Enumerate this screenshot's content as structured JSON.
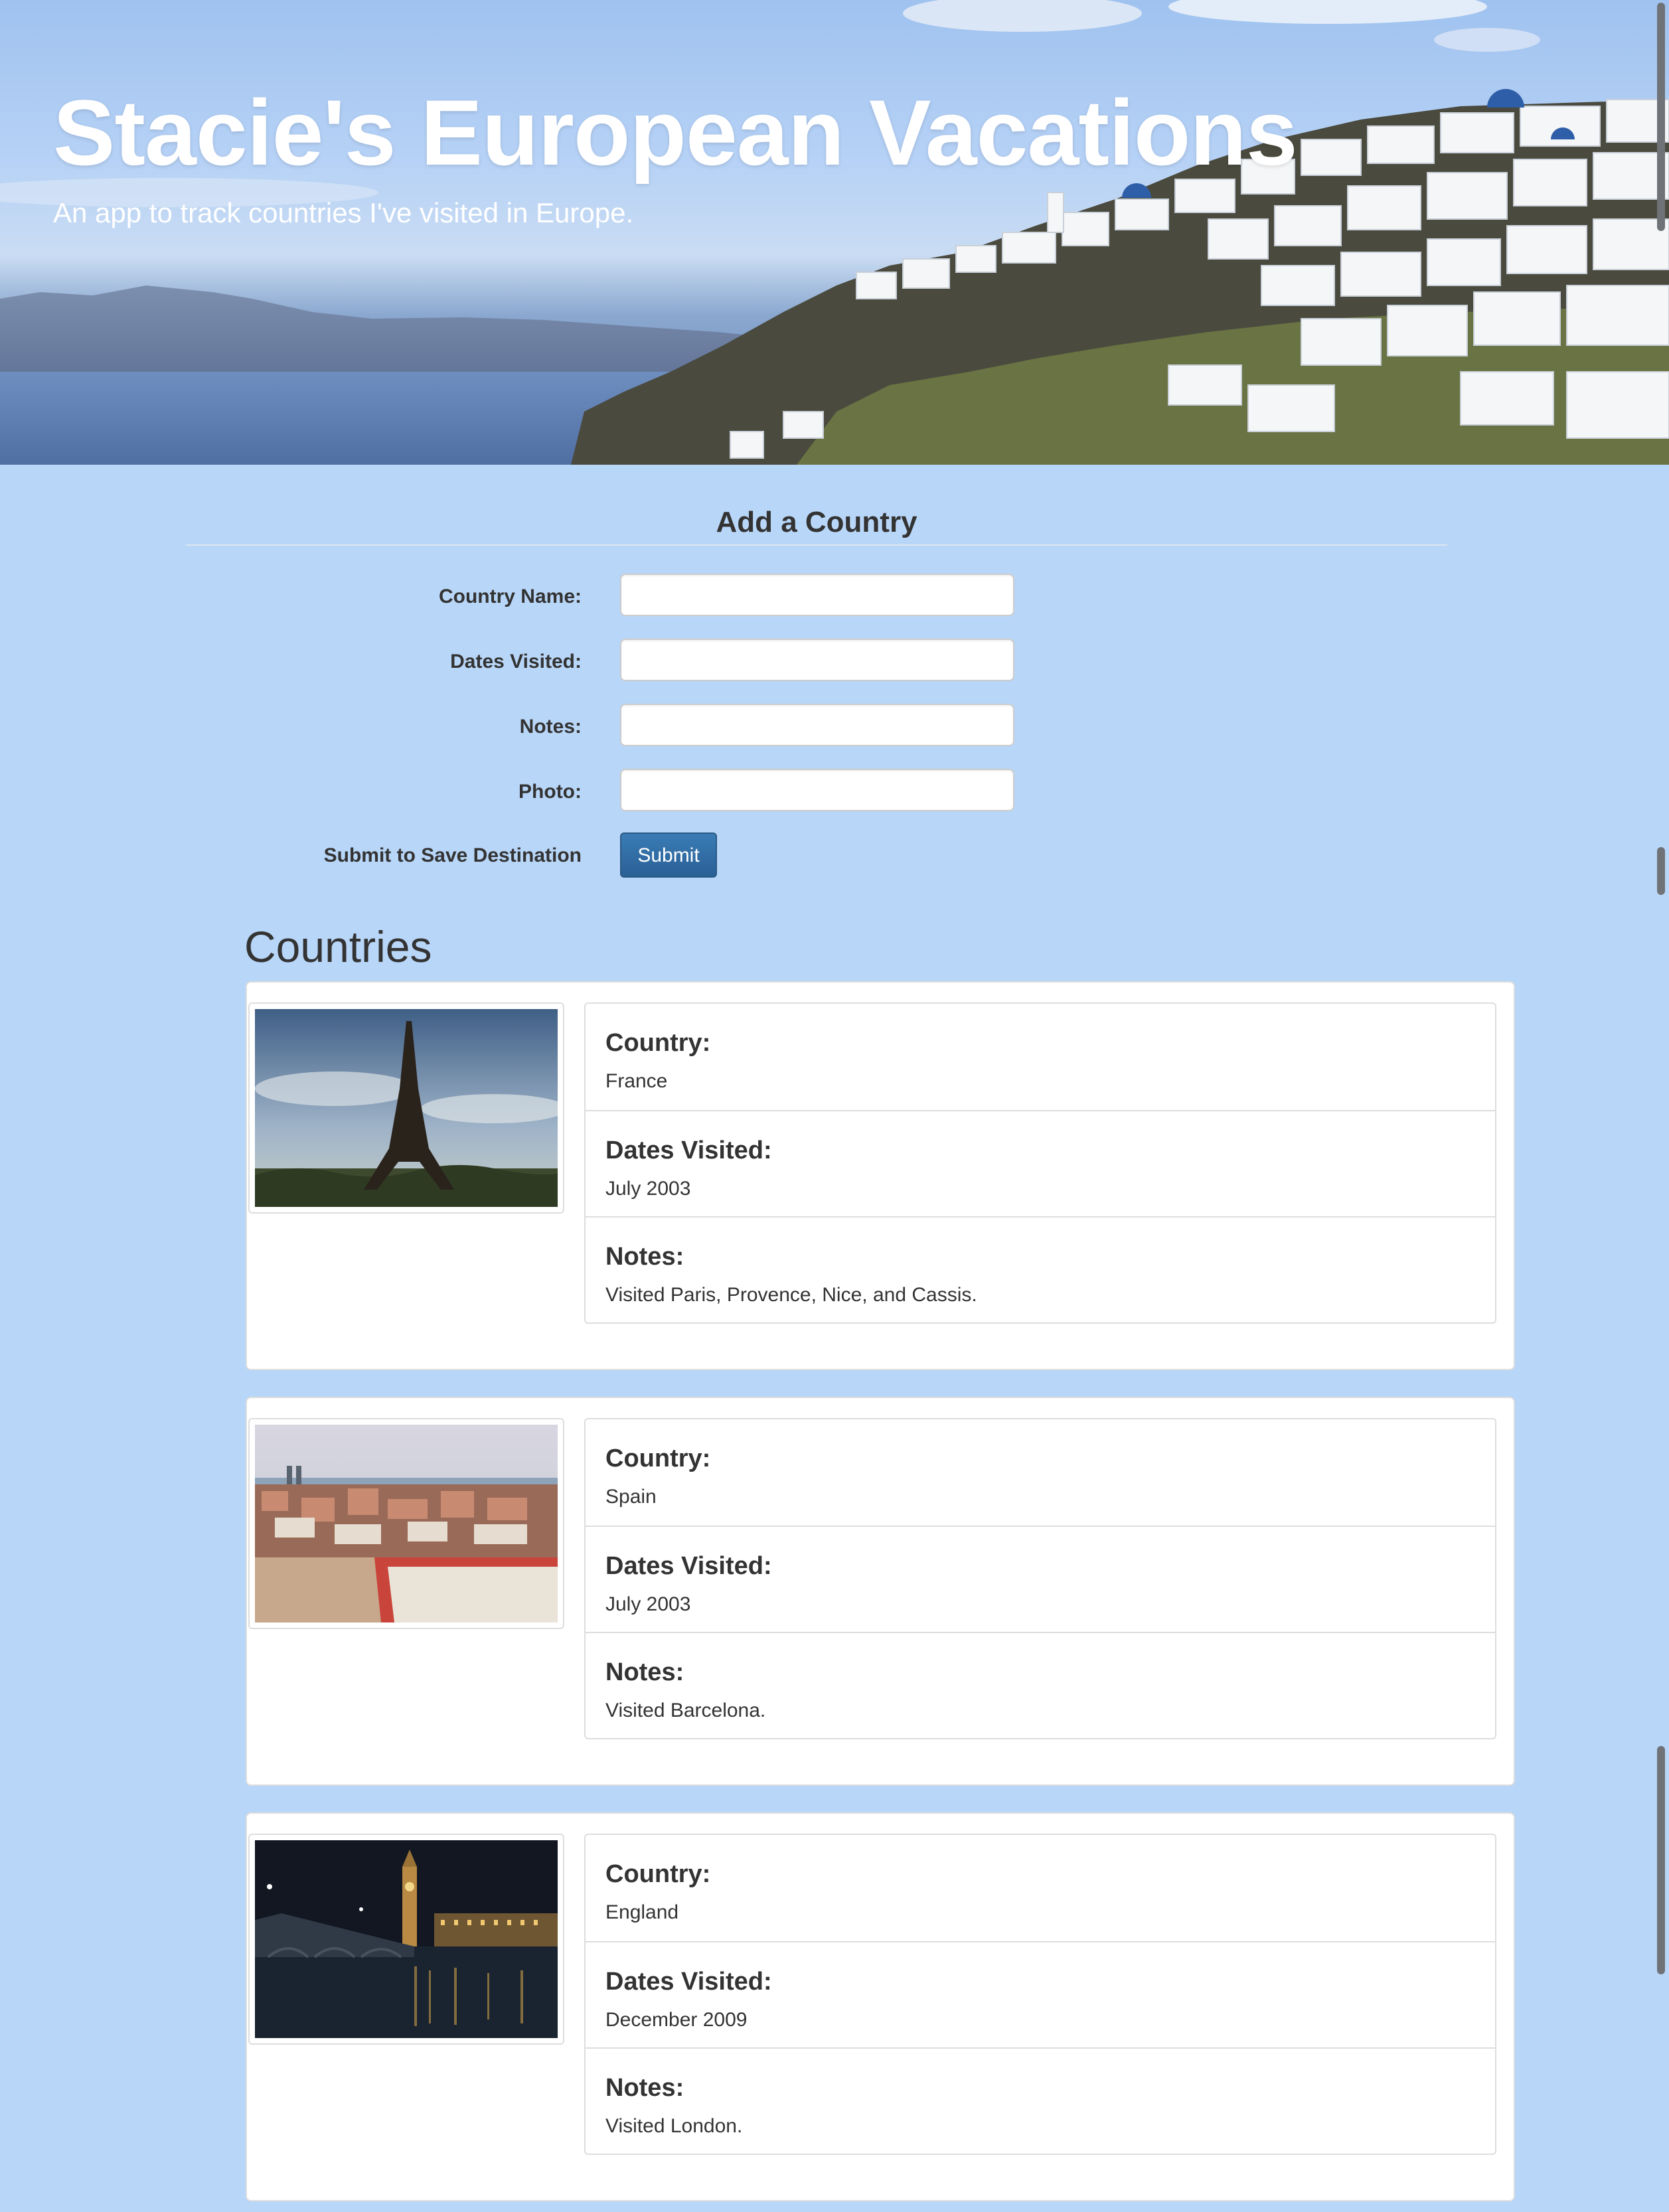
{
  "hero": {
    "title": "Stacie's European Vacations",
    "subtitle": "An app to track countries I've visited in Europe."
  },
  "form": {
    "title": "Add a Country",
    "fields": [
      {
        "label": "Country Name:",
        "value": "",
        "placeholder": ""
      },
      {
        "label": "Dates Visited:",
        "value": "",
        "placeholder": ""
      },
      {
        "label": "Notes:",
        "value": "",
        "placeholder": ""
      },
      {
        "label": "Photo:",
        "value": "",
        "placeholder": ""
      }
    ],
    "submit_label": "Submit to Save Destination",
    "submit_button": "Submit"
  },
  "countries": {
    "heading": "Countries",
    "labels": {
      "country": "Country:",
      "dates": "Dates Visited:",
      "notes": "Notes:"
    },
    "items": [
      {
        "country": "France",
        "dates": "July 2003",
        "notes": "Visited Paris, Provence, Nice, and Cassis.",
        "photo": "eiffel-tower"
      },
      {
        "country": "Spain",
        "dates": "July 2003",
        "notes": "Visited Barcelona.",
        "photo": "barcelona-cityscape"
      },
      {
        "country": "England",
        "dates": "December 2009",
        "notes": "Visited London.",
        "photo": "big-ben-night"
      }
    ]
  },
  "colors": {
    "page_background": "#b8d6f8",
    "submit_button": "#2a6096",
    "text": "#333333"
  }
}
